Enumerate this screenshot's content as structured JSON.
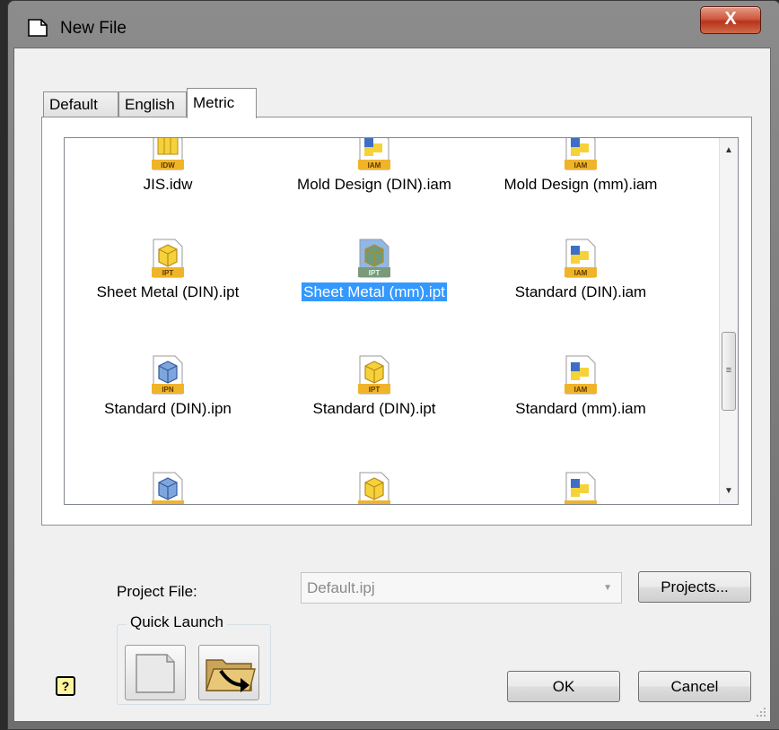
{
  "window": {
    "title": "New File",
    "close_label": "X"
  },
  "tabs": [
    {
      "label": "Default",
      "active": false
    },
    {
      "label": "English",
      "active": false
    },
    {
      "label": "Metric",
      "active": true
    }
  ],
  "templates": [
    {
      "label": "JIS.idw",
      "icon": "idw-drawing-icon",
      "badge": "IDW"
    },
    {
      "label": "Mold Design (DIN).iam",
      "icon": "iam-assembly-icon",
      "badge": "IAM"
    },
    {
      "label": "Mold Design (mm).iam",
      "icon": "iam-assembly-icon",
      "badge": "IAM"
    },
    {
      "label": "Sheet Metal (DIN).ipt",
      "icon": "ipt-part-icon",
      "badge": "IPT"
    },
    {
      "label": "Sheet Metal (mm).ipt",
      "icon": "ipt-part-icon",
      "badge": "IPT",
      "selected": true
    },
    {
      "label": "Standard (DIN).iam",
      "icon": "iam-assembly-icon",
      "badge": "IAM"
    },
    {
      "label": "Standard (DIN).ipn",
      "icon": "ipn-presentation-icon",
      "badge": "IPN"
    },
    {
      "label": "Standard (DIN).ipt",
      "icon": "ipt-part-icon",
      "badge": "IPT"
    },
    {
      "label": "Standard (mm).iam",
      "icon": "iam-assembly-icon",
      "badge": "IAM"
    },
    {
      "label": "",
      "icon": "ipn-presentation-icon",
      "badge": ""
    },
    {
      "label": "",
      "icon": "ipt-part-icon",
      "badge": ""
    },
    {
      "label": "",
      "icon": "iam-assembly-icon",
      "badge": ""
    }
  ],
  "project": {
    "label": "Project File:",
    "value": "Default.ipj",
    "projects_button": "Projects..."
  },
  "quick_launch": {
    "label": "Quick Launch"
  },
  "buttons": {
    "ok": "OK",
    "cancel": "Cancel",
    "help": "?"
  }
}
